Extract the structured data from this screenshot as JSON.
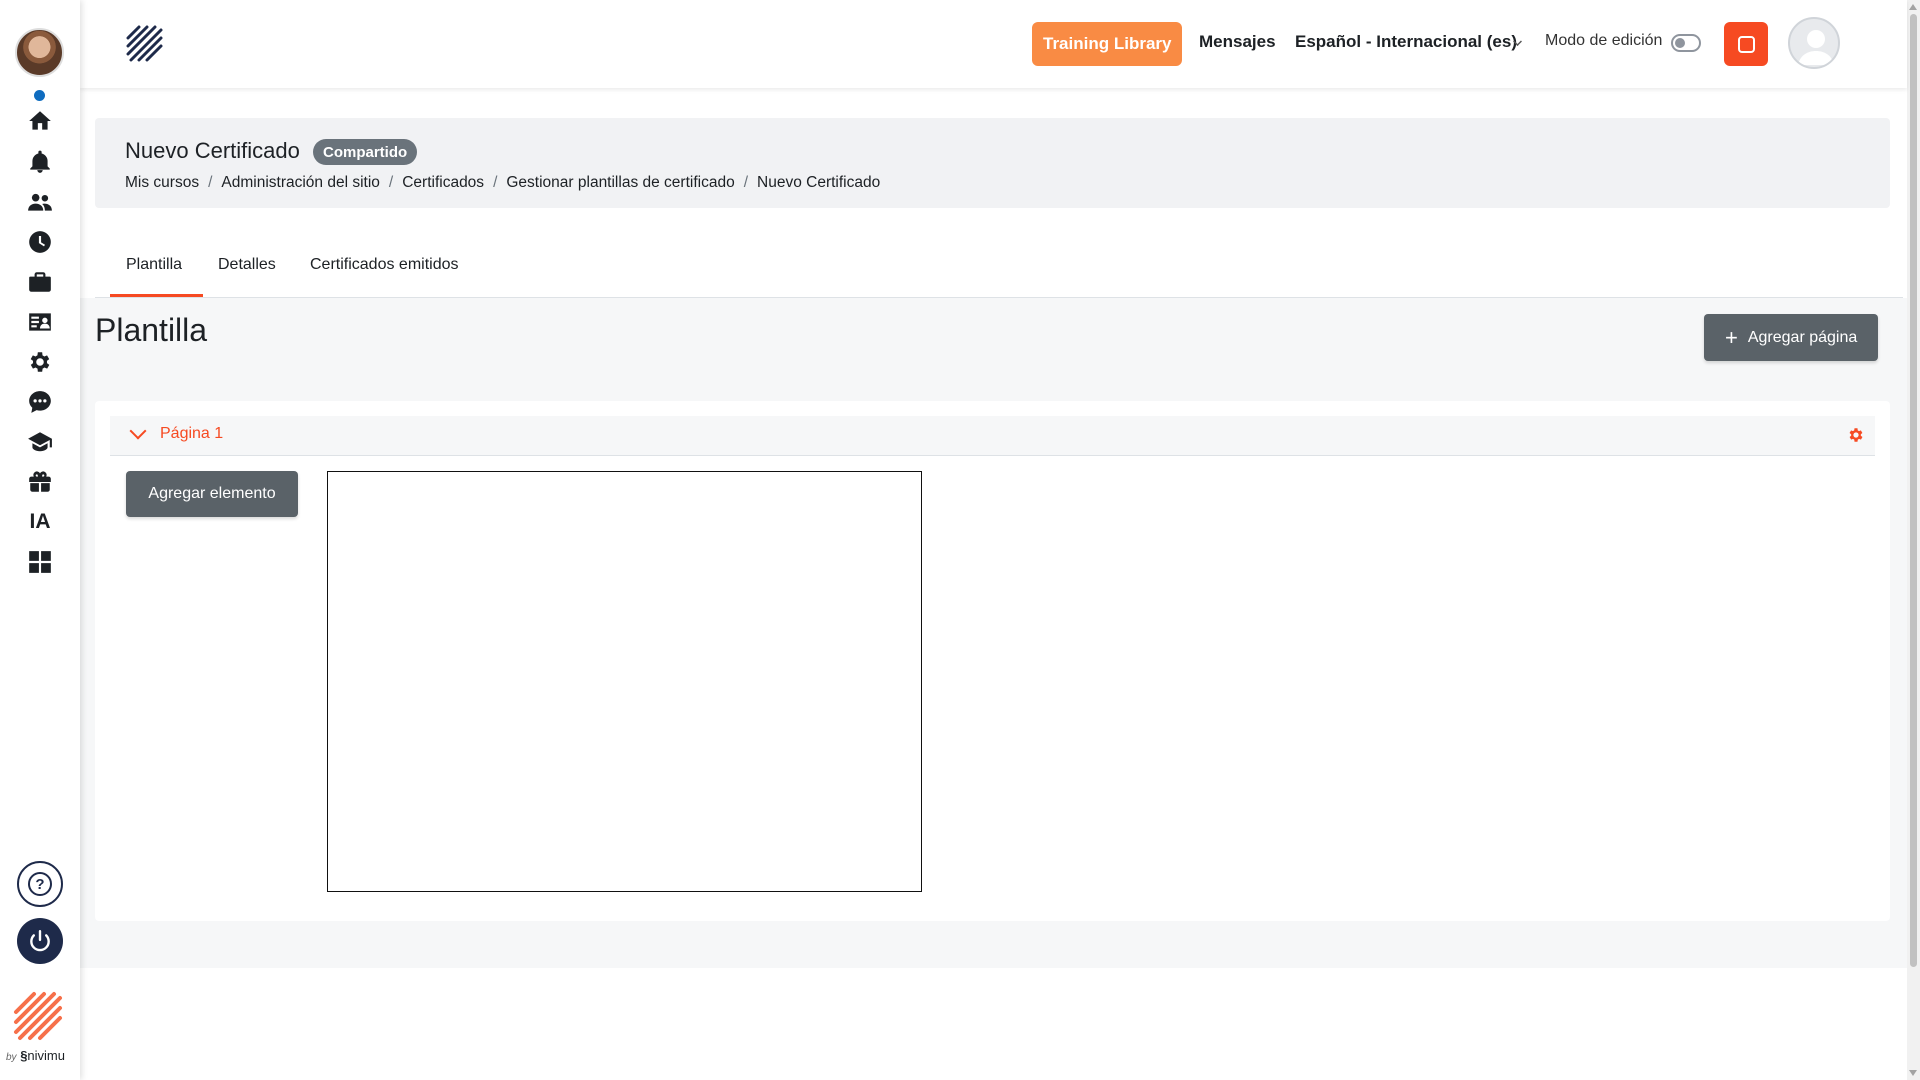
{
  "colors": {
    "accent": "#f64a22",
    "training_button": "#f98b44",
    "dark_button": "#5a6268",
    "rail_dark": "#1e2a4a"
  },
  "rail": {
    "items": [
      {
        "icon": "home-icon"
      },
      {
        "icon": "bell-icon"
      },
      {
        "icon": "users-icon"
      },
      {
        "icon": "clock-icon"
      },
      {
        "icon": "briefcase-icon"
      },
      {
        "icon": "id-card-icon"
      },
      {
        "icon": "gear-icon"
      },
      {
        "icon": "chat-icon"
      },
      {
        "icon": "graduation-cap-icon"
      },
      {
        "icon": "gift-icon"
      },
      {
        "icon": "ia-icon",
        "label": "IA"
      },
      {
        "icon": "grid-icon"
      }
    ],
    "help_icon": "question-icon",
    "power_icon": "power-icon",
    "byline_prefix": "by",
    "byline_brand": "nivimu"
  },
  "topbar": {
    "training_label": "Training Library",
    "messages_label": "Mensajes",
    "language_label": "Español - Internacional (es)",
    "edit_mode_label": "Modo de edición"
  },
  "header": {
    "title": "Nuevo Certificado",
    "badge": "Compartido",
    "breadcrumb": [
      "Mis cursos",
      "Administración del sitio",
      "Certificados",
      "Gestionar plantillas de certificado",
      "Nuevo Certificado"
    ]
  },
  "tabs": [
    {
      "label": "Plantilla",
      "active": true
    },
    {
      "label": "Detalles",
      "active": false
    },
    {
      "label": "Certificados emitidos",
      "active": false
    }
  ],
  "main": {
    "section_title": "Plantilla",
    "add_page_label": "Agregar página",
    "page": {
      "label": "Página 1",
      "add_element_label": "Agregar elemento"
    }
  }
}
